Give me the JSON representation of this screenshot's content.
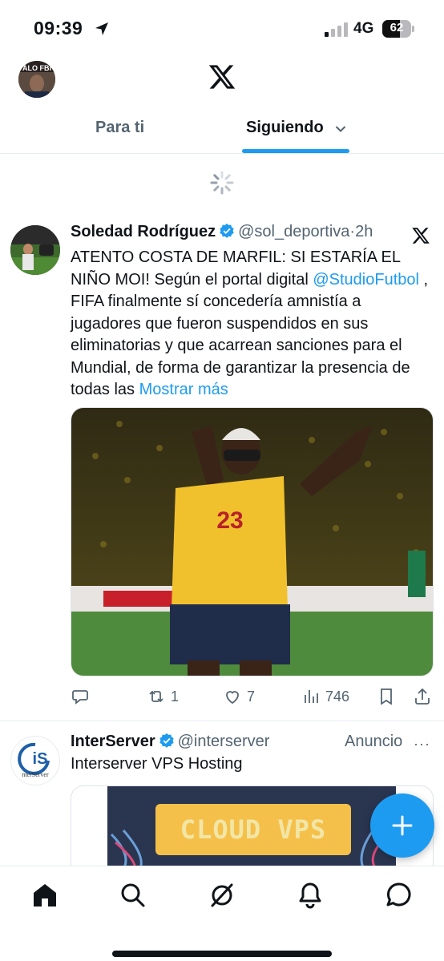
{
  "status_bar": {
    "time": "09:39",
    "network": "4G",
    "battery": "62",
    "battery_level": 0.62
  },
  "header": {
    "avatar_label": "ALO FBI"
  },
  "tabs": [
    {
      "label": "Para ti",
      "active": false
    },
    {
      "label": "Siguiendo",
      "active": true
    }
  ],
  "tweet": {
    "author": "Soledad Rodríguez",
    "handle": "@sol_deportiva",
    "separator": "·",
    "time": "2h",
    "text_1": "ATENTO COSTA DE MARFIL: SI ESTARÍA EL NIÑO MOI! Según el portal digital ",
    "mention": "@StudioFutbol",
    "text_2": " , FIFA finalmente sí concedería amnistía a jugadores que fueron suspendidos en sus eliminatorias y que acarrean sanciones para el Mundial, de forma de garantizar la presencia de todas las ",
    "more": "Mostrar más",
    "jersey_number": "23",
    "stats": {
      "retweets": "1",
      "likes": "7",
      "views": "746"
    }
  },
  "ad": {
    "name": "InterServer",
    "handle": "@interserver",
    "label": "Anuncio",
    "more": "···",
    "text": "Interserver VPS Hosting",
    "logo_text": "nterServer",
    "banner": "CLOUD VPS"
  },
  "nav": {
    "items": [
      "home-icon",
      "search-icon",
      "grok-icon",
      "notifications-icon",
      "messages-icon"
    ]
  },
  "colors": {
    "accent": "#1d9bf0",
    "text": "#0f1419",
    "secondary": "#536471",
    "jersey": "#f4c430"
  }
}
